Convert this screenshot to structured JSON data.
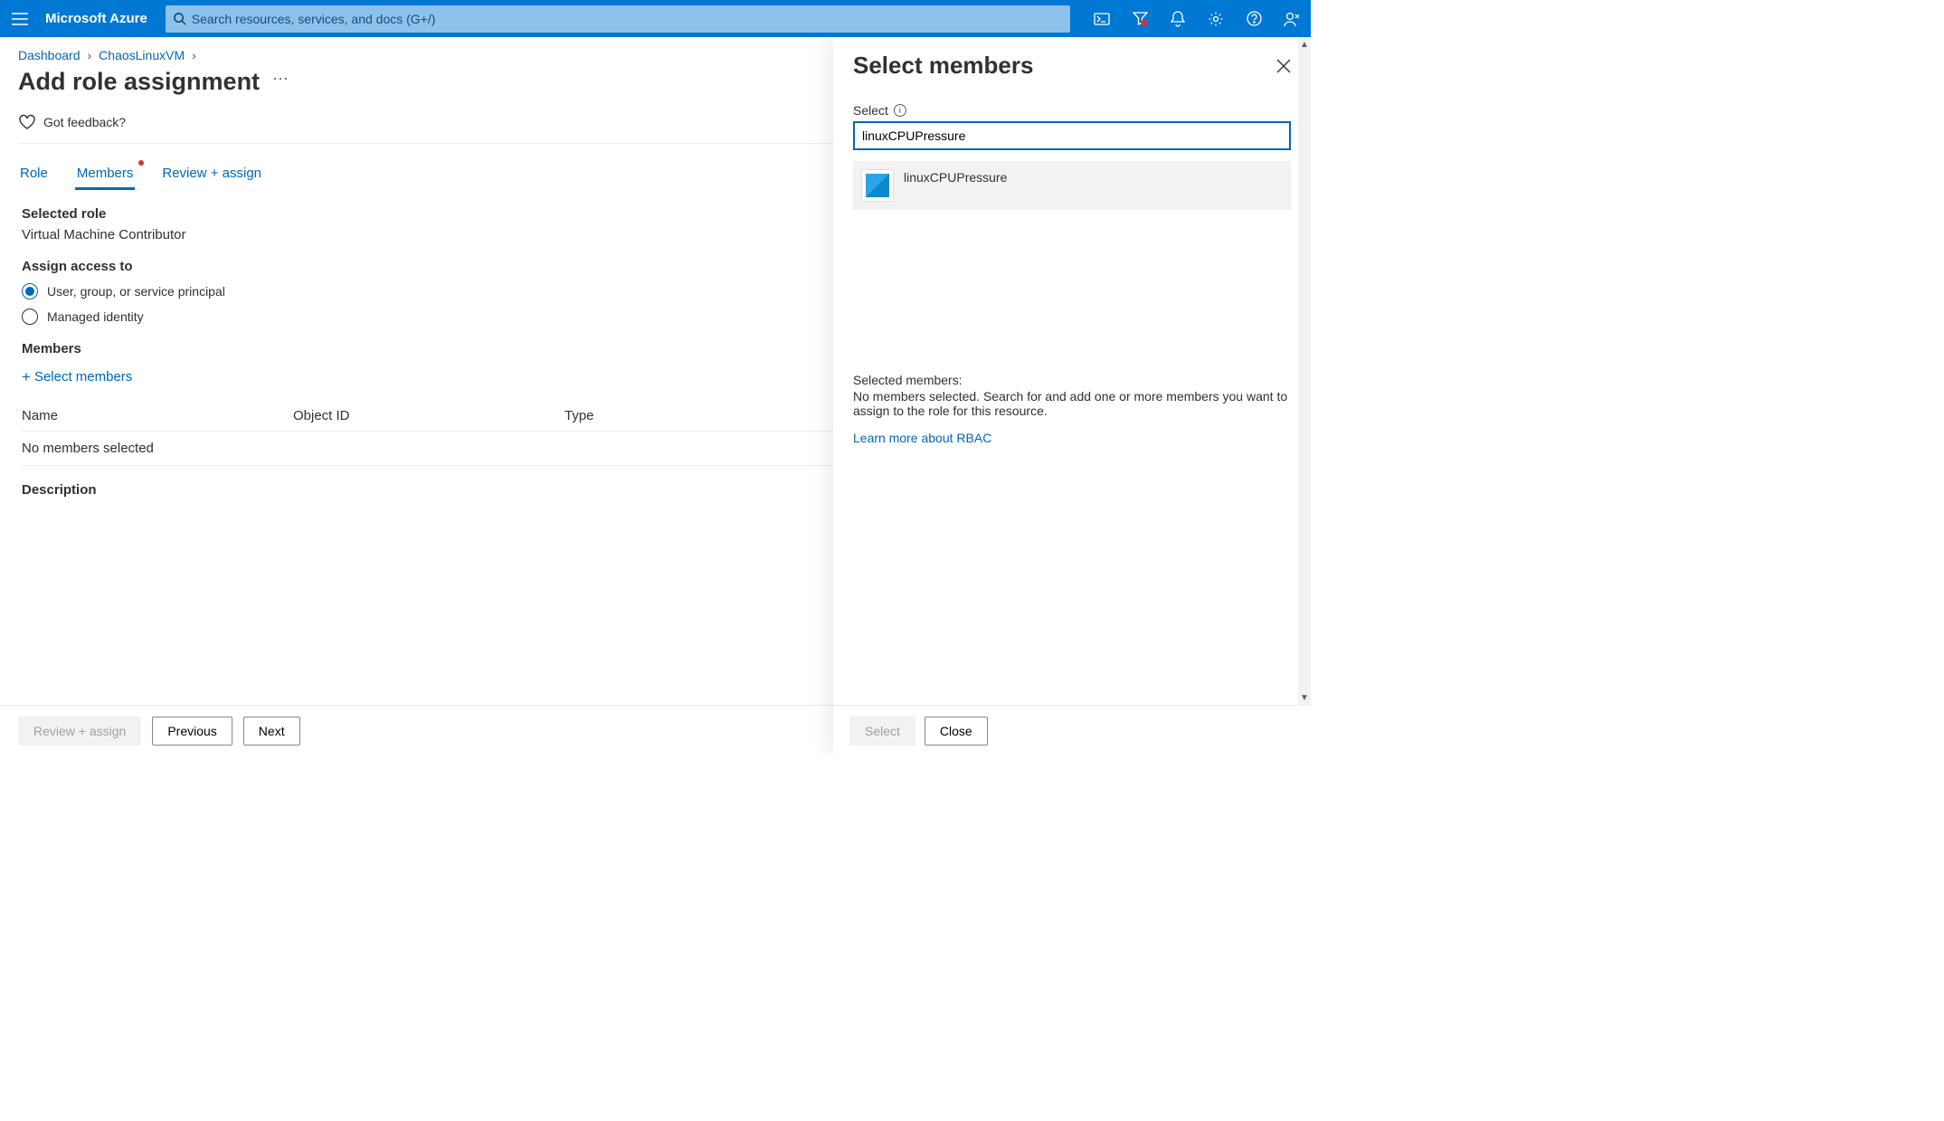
{
  "topbar": {
    "brand": "Microsoft Azure",
    "search_placeholder": "Search resources, services, and docs (G+/)"
  },
  "breadcrumb": {
    "items": [
      "Dashboard",
      "ChaosLinuxVM"
    ]
  },
  "page": {
    "title": "Add role assignment",
    "feedback": "Got feedback?"
  },
  "tabs": [
    "Role",
    "Members",
    "Review + assign"
  ],
  "active_tab": "Members",
  "selected_role": {
    "label": "Selected role",
    "value": "Virtual Machine Contributor"
  },
  "assign_access": {
    "label": "Assign access to",
    "options": [
      "User, group, or service principal",
      "Managed identity"
    ],
    "selected": 0
  },
  "members": {
    "label": "Members",
    "select_link": "Select members",
    "columns": [
      "Name",
      "Object ID",
      "Type"
    ],
    "empty": "No members selected"
  },
  "description_label": "Description",
  "footer": {
    "review": "Review + assign",
    "previous": "Previous",
    "next": "Next"
  },
  "panel": {
    "title": "Select members",
    "field_label": "Select",
    "input_value": "linuxCPUPressure",
    "result_name": "linuxCPUPressure",
    "selected_label": "Selected members:",
    "selected_msg": "No members selected. Search for and add one or more members you want to assign to the role for this resource.",
    "learn_link": "Learn more about RBAC",
    "select_btn": "Select",
    "close_btn": "Close"
  }
}
